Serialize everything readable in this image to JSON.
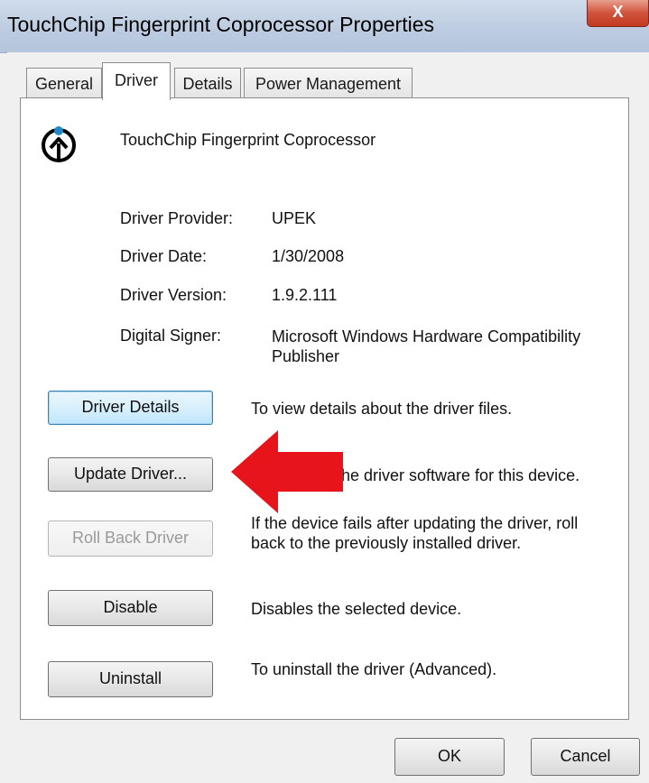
{
  "window": {
    "title": "TouchChip Fingerprint Coprocessor Properties",
    "close_label": "X"
  },
  "tabs": [
    {
      "label": "General",
      "active": false
    },
    {
      "label": "Driver",
      "active": true
    },
    {
      "label": "Details",
      "active": false
    },
    {
      "label": "Power Management",
      "active": false
    }
  ],
  "device": {
    "name": "TouchChip Fingerprint Coprocessor",
    "icon": "fingerprint-device-icon"
  },
  "info": [
    {
      "label": "Driver Provider:",
      "value": "UPEK"
    },
    {
      "label": "Driver Date:",
      "value": "1/30/2008"
    },
    {
      "label": "Driver Version:",
      "value": "1.9.2.111"
    },
    {
      "label": "Digital Signer:",
      "value": "Microsoft Windows Hardware Compatibility Publisher"
    }
  ],
  "actions": [
    {
      "button": "Driver Details",
      "description": "To view details about the driver files.",
      "state": "focused"
    },
    {
      "button": "Update Driver...",
      "description": "he driver software for this device.",
      "state": "normal"
    },
    {
      "button": "Roll Back Driver",
      "description": "If the device fails after updating the driver, roll back to the previously installed driver.",
      "state": "disabled"
    },
    {
      "button": "Disable",
      "description": "Disables the selected device.",
      "state": "normal"
    },
    {
      "button": "Uninstall",
      "description": "To uninstall the driver (Advanced).",
      "state": "normal"
    }
  ],
  "footer": {
    "ok_label": "OK",
    "cancel_label": "Cancel"
  },
  "annotation": {
    "arrow_color": "#e8141b",
    "arrow_icon": "red-arrow-pointing-left"
  },
  "colors": {
    "titlebar": "#bccbe0",
    "close_button": "#c8452f",
    "focused_button_border": "#3c7fb1"
  }
}
